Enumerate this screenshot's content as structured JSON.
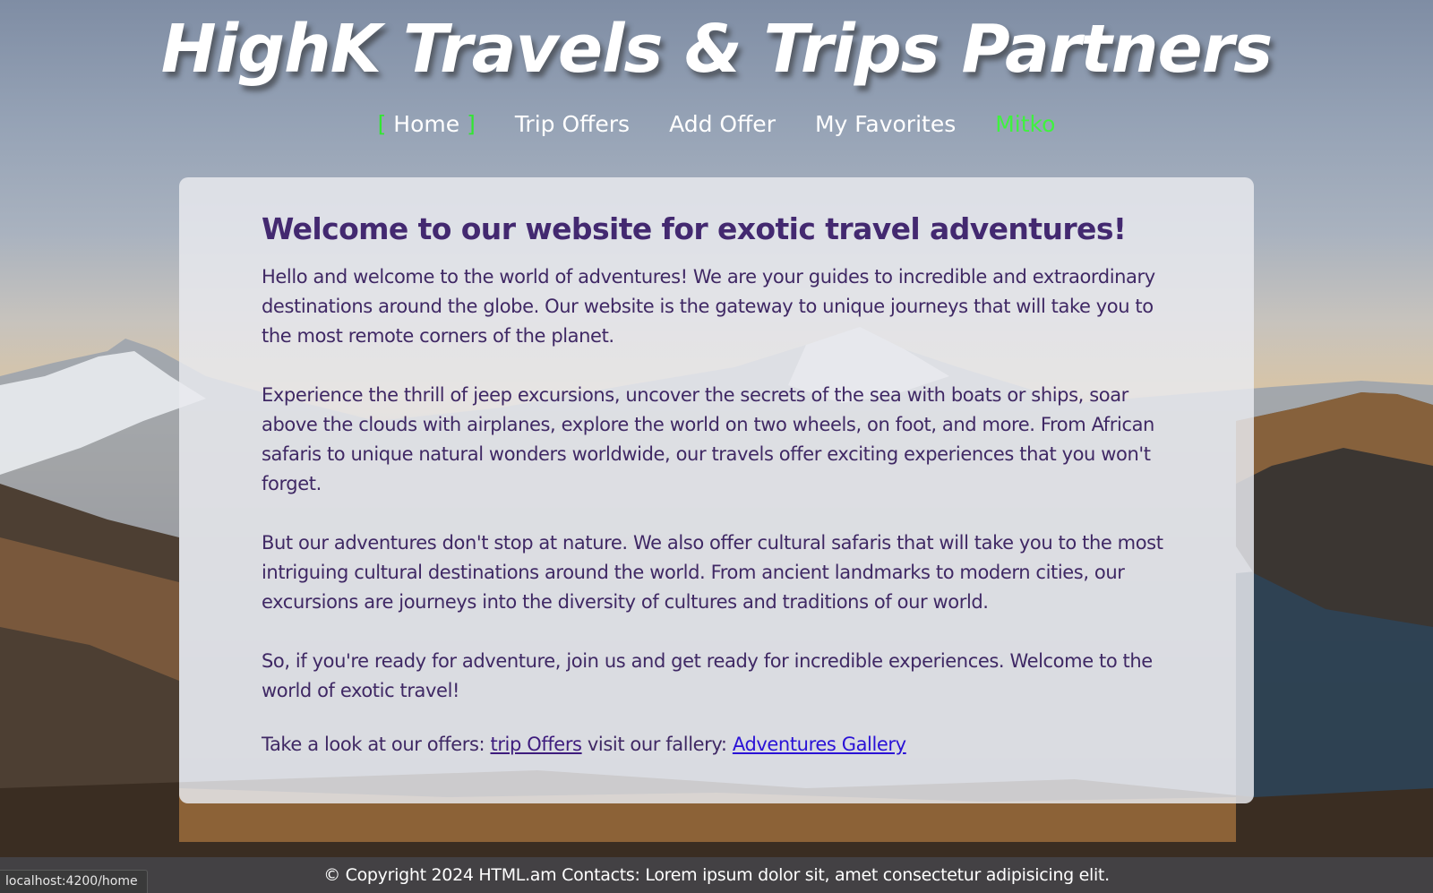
{
  "site": {
    "title": "HighK Travels & Trips Partners"
  },
  "nav": {
    "home_bracket_open": "[",
    "home": "Home",
    "home_bracket_close": "]",
    "trip_offers": "Trip Offers",
    "add_offer": "Add Offer",
    "my_favorites": "My Favorites",
    "user": "Mitko"
  },
  "main": {
    "heading": "Welcome to our website for exotic travel adventures!",
    "paragraphs": [
      "Hello and welcome to the world of adventures! We are your guides to incredible and extraordinary destinations around the globe. Our website is the gateway to unique journeys that will take you to the most remote corners of the planet.",
      "Experience the thrill of jeep excursions, uncover the secrets of the sea with boats or ships, soar above the clouds with airplanes, explore the world on two wheels, on foot, and more. From African safaris to unique natural wonders worldwide, our travels offer exciting experiences that you won't forget.",
      "But our adventures don't stop at nature. We also offer cultural safaris that will take you to the most intriguing cultural destinations around the world. From ancient landmarks to modern cities, our excursions are journeys into the diversity of cultures and traditions of our world.",
      "So, if you're ready for adventure, join us and get ready for incredible experiences. Welcome to the world of exotic travel!"
    ],
    "offers_prefix": "Take a look at our offers:",
    "offers_link": "trip Offers",
    "gallery_prefix": "visit our fallery:",
    "gallery_link": "Adventures Gallery"
  },
  "footer": {
    "text": "© Copyright 2024 HTML.am Contacts: Lorem ipsum dolor sit, amet consectetur adipisicing elit."
  },
  "status_bar": {
    "url": "localhost:4200/home"
  },
  "colors": {
    "nav_active": "#32e632",
    "heading": "#432970",
    "body_text": "#3f2864",
    "link": "#2a12d6"
  }
}
